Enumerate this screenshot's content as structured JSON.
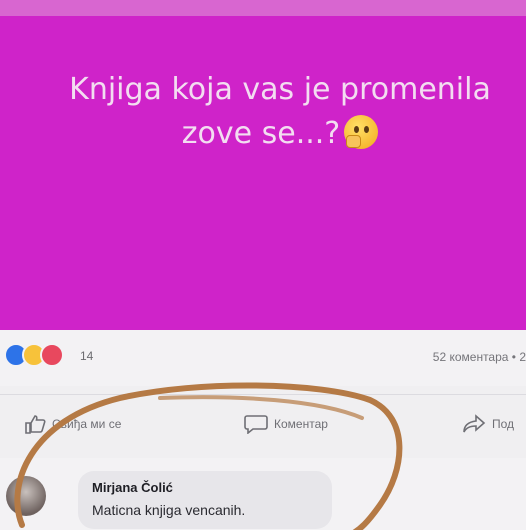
{
  "post": {
    "line1": "Knjiga koja vas je promenila",
    "line2": "zove se...?",
    "background": "#cf23c9",
    "emoji_icon": "thinking-face-icon"
  },
  "stats": {
    "reaction_count": "14",
    "comments_count": "52 коментара • 2"
  },
  "actions": {
    "like_label": "Свиђа ми се",
    "comment_label": "Коментар",
    "share_label": "Под"
  },
  "comment": {
    "author": "Mirjana Čolić",
    "text": "Maticna knjiga vencanih."
  },
  "annotation": {
    "color": "#b57a45"
  }
}
